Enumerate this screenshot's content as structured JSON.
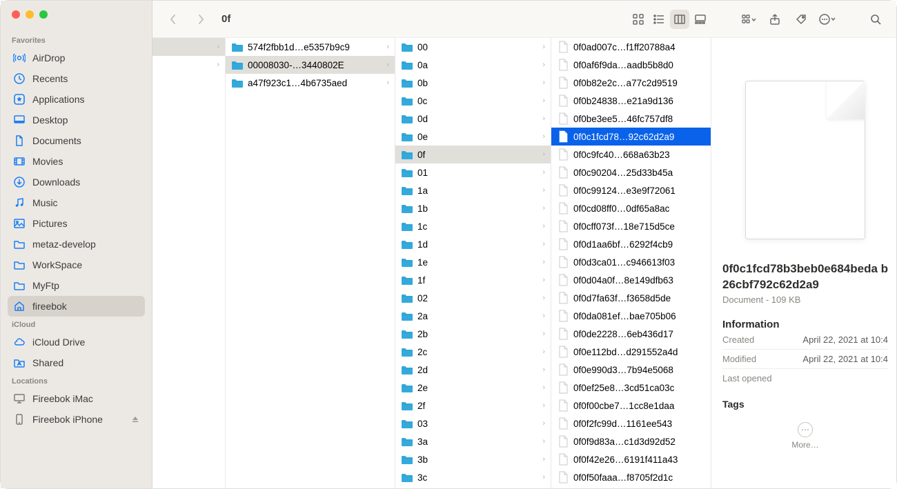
{
  "window": {
    "title": "0f"
  },
  "sidebar": {
    "sections": [
      {
        "label": "Favorites",
        "items": [
          {
            "icon": "airdrop",
            "label": "AirDrop"
          },
          {
            "icon": "clock",
            "label": "Recents"
          },
          {
            "icon": "apps",
            "label": "Applications"
          },
          {
            "icon": "desktop",
            "label": "Desktop"
          },
          {
            "icon": "doc",
            "label": "Documents"
          },
          {
            "icon": "movie",
            "label": "Movies"
          },
          {
            "icon": "download",
            "label": "Downloads"
          },
          {
            "icon": "music",
            "label": "Music"
          },
          {
            "icon": "pic",
            "label": "Pictures"
          },
          {
            "icon": "folder",
            "label": "metaz-develop"
          },
          {
            "icon": "folder",
            "label": "WorkSpace"
          },
          {
            "icon": "folder",
            "label": "MyFtp"
          },
          {
            "icon": "home",
            "label": "fireebok",
            "selected": true
          }
        ]
      },
      {
        "label": "iCloud",
        "items": [
          {
            "icon": "cloud",
            "label": "iCloud Drive"
          },
          {
            "icon": "sharefolder",
            "label": "Shared"
          }
        ]
      },
      {
        "label": "Locations",
        "items": [
          {
            "icon": "monitor",
            "gray": true,
            "label": "Fireebok iMac"
          },
          {
            "icon": "phone",
            "gray": true,
            "label": "Fireebok iPhone",
            "eject": true
          }
        ]
      }
    ]
  },
  "column1": [
    {
      "kind": "folder",
      "label": "",
      "sel": true
    },
    {
      "kind": "folder",
      "label": ""
    }
  ],
  "column2": [
    {
      "kind": "folder",
      "label": "574f2fbb1d…e5357b9c9"
    },
    {
      "kind": "folder",
      "label": "00008030-…3440802E",
      "sel": true
    },
    {
      "kind": "folder",
      "label": "a47f923c1…4b6735aed"
    }
  ],
  "column3": [
    {
      "label": "00"
    },
    {
      "label": "0a"
    },
    {
      "label": "0b"
    },
    {
      "label": "0c"
    },
    {
      "label": "0d"
    },
    {
      "label": "0e"
    },
    {
      "label": "0f",
      "sel": true
    },
    {
      "label": "01"
    },
    {
      "label": "1a"
    },
    {
      "label": "1b"
    },
    {
      "label": "1c"
    },
    {
      "label": "1d"
    },
    {
      "label": "1e"
    },
    {
      "label": "1f"
    },
    {
      "label": "02"
    },
    {
      "label": "2a"
    },
    {
      "label": "2b"
    },
    {
      "label": "2c"
    },
    {
      "label": "2d"
    },
    {
      "label": "2e"
    },
    {
      "label": "2f"
    },
    {
      "label": "03"
    },
    {
      "label": "3a"
    },
    {
      "label": "3b"
    },
    {
      "label": "3c"
    }
  ],
  "column4": [
    {
      "label": "0f0ad007c…f1ff20788a4"
    },
    {
      "label": "0f0af6f9da…aadb5b8d0"
    },
    {
      "label": "0f0b82e2c…a77c2d9519"
    },
    {
      "label": "0f0b24838…e21a9d136"
    },
    {
      "label": "0f0be3ee5…46fc757df8"
    },
    {
      "label": "0f0c1fcd78…92c62d2a9",
      "sel": true
    },
    {
      "label": "0f0c9fc40…668a63b23"
    },
    {
      "label": "0f0c90204…25d33b45a"
    },
    {
      "label": "0f0c99124…e3e9f72061"
    },
    {
      "label": "0f0cd08ff0…0df65a8ac"
    },
    {
      "label": "0f0cff073f…18e715d5ce"
    },
    {
      "label": "0f0d1aa6bf…6292f4cb9"
    },
    {
      "label": "0f0d3ca01…c946613f03"
    },
    {
      "label": "0f0d04a0f…8e149dfb63"
    },
    {
      "label": "0f0d7fa63f…f3658d5de"
    },
    {
      "label": "0f0da081ef…bae705b06"
    },
    {
      "label": "0f0de2228…6eb436d17"
    },
    {
      "label": "0f0e112bd…d291552a4d"
    },
    {
      "label": "0f0e990d3…7b94e5068"
    },
    {
      "label": "0f0ef25e8…3cd51ca03c"
    },
    {
      "label": "0f0f00cbe7…1cc8e1daa"
    },
    {
      "label": "0f0f2fc99d…1161ee543"
    },
    {
      "label": "0f0f9d83a…c1d3d92d52"
    },
    {
      "label": "0f0f42e26…6191f411a43"
    },
    {
      "label": "0f0f50faaa…f8705f2d1c"
    }
  ],
  "preview": {
    "filename": "0f0c1fcd78b3beb0e684beda b26cbf792c62d2a9",
    "subtitle": "Document - 109 KB",
    "info_header": "Information",
    "created_key": "Created",
    "created_val": "April 22, 2021 at 10:4",
    "modified_key": "Modified",
    "modified_val": "April 22, 2021 at 10:4",
    "lastopened_key": "Last opened",
    "tags_header": "Tags",
    "more_label": "More…"
  }
}
